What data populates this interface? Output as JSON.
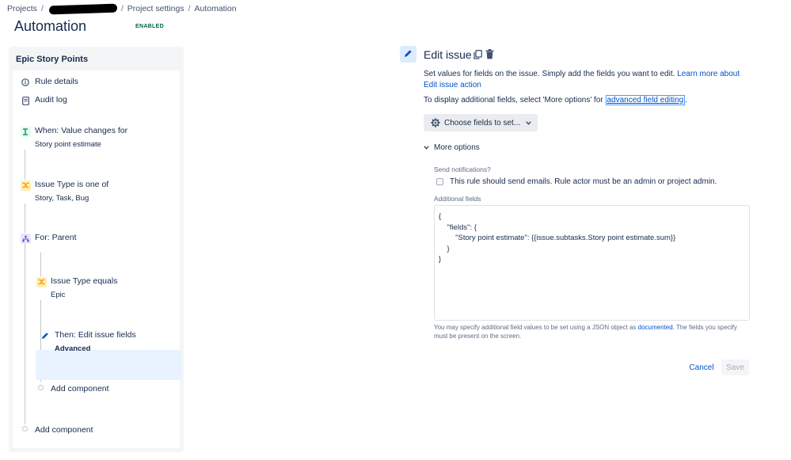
{
  "breadcrumb": {
    "projects": "Projects",
    "sep1": "/",
    "sep2": "/",
    "project_settings": "Project settings",
    "sep3": "/",
    "automation": "Automation"
  },
  "header": {
    "title": "Automation",
    "status": "ENABLED"
  },
  "rule": {
    "name": "Epic Story Points",
    "items": {
      "rule_details": "Rule details",
      "audit_log": "Audit log"
    },
    "components": {
      "trigger": {
        "label": "When: Value changes for",
        "detail": "Story point estimate"
      },
      "condition1": {
        "label": "Issue Type is one of",
        "detail": "Story, Task, Bug"
      },
      "branch": {
        "label": "For: Parent"
      },
      "condition2": {
        "label": "Issue Type equals",
        "detail": "Epic"
      },
      "action": {
        "label": "Then: Edit issue fields",
        "detail": "Advanced"
      },
      "add_inner": "Add component",
      "add_outer": "Add component"
    }
  },
  "editor": {
    "title": "Edit issue",
    "description": "Set values for fields on the issue. Simply add the fields you want to edit.",
    "learn_more": "Learn more about Edit issue action",
    "additional_prefix": "To display additional fields, select 'More options' for",
    "additional_link": "advanced field editing",
    "additional_suffix": ".",
    "choose_fields": "Choose fields to set...",
    "more_options": "More options",
    "send_notifications_label": "Send notifications?",
    "send_notifications_text": "This rule should send emails. Rule actor must be an admin or project admin.",
    "additional_fields_label": "Additional fields",
    "additional_fields_value": "{\n    \"fields\": {\n        \"Story point estimate\": {{issue.subtasks.Story point estimate.sum}}\n    }\n}",
    "help_prefix": "You may specify additional field values to be set using a JSON object as",
    "help_link": "documented",
    "help_suffix": ". The fields you specify must be present on the screen.",
    "cancel": "Cancel",
    "save": "Save"
  },
  "icons": {
    "rule_details": "info-icon",
    "audit_log": "document-icon",
    "trigger": "trigger-icon",
    "condition": "condition-icon",
    "branch": "branch-icon",
    "action": "pencil-icon"
  }
}
